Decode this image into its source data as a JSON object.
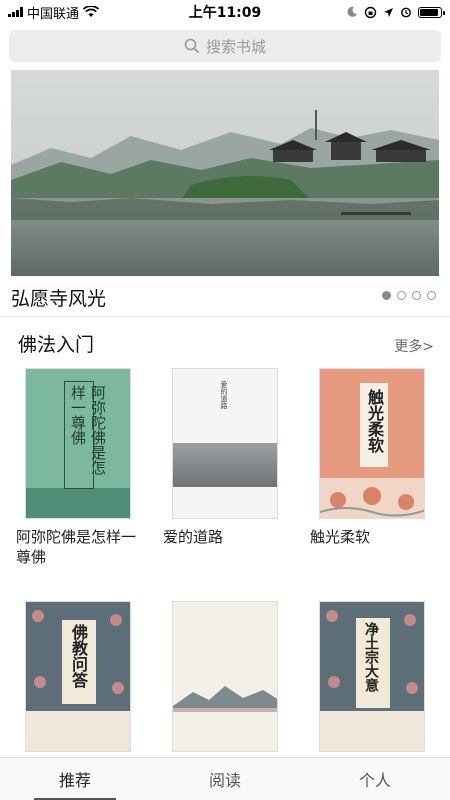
{
  "status_bar": {
    "carrier": "中国联通",
    "time": "上午11:09",
    "battery_level": 0.9
  },
  "search": {
    "placeholder": "搜索书城"
  },
  "banner": {
    "caption": "弘愿寺风光",
    "page_count": 4,
    "active_index": 0
  },
  "section": {
    "title": "佛法入门",
    "more": "更多>"
  },
  "books": [
    {
      "title": "阿弥陀佛是怎样一尊佛",
      "cover_text": "阿弥陀佛是怎样一尊佛",
      "cover_color": "#7cb8a0"
    },
    {
      "title": "爱的道路",
      "cover_text": "爱的道路",
      "cover_color": "#f5f5f5"
    },
    {
      "title": "触光柔软",
      "cover_text": "触光柔软",
      "cover_color": "#e69a80"
    },
    {
      "title": "",
      "cover_text": "佛教问答",
      "cover_color": "#5c6f78"
    },
    {
      "title": "",
      "cover_text": "",
      "cover_color": "#f3f0e8"
    },
    {
      "title": "",
      "cover_text": "净土宗大意",
      "cover_color": "#5c6f78"
    }
  ],
  "tabs": [
    {
      "label": "推荐"
    },
    {
      "label": "阅读"
    },
    {
      "label": "个人"
    }
  ]
}
